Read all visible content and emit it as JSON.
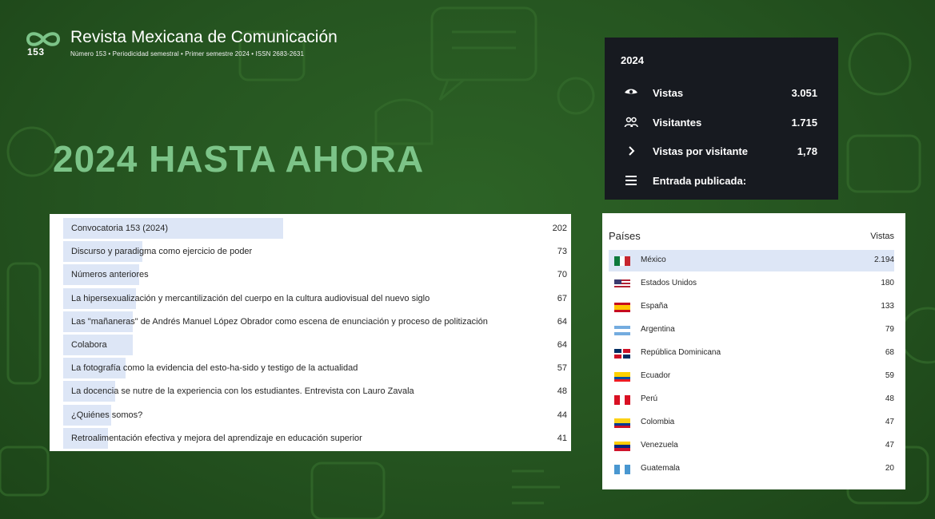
{
  "header": {
    "logo_number": "153",
    "title": "Revista Mexicana de Comunicación",
    "subtitle": "Número 153  •  Periodicidad semestral  •  Primer semestre 2024  •  ISSN 2683-2631"
  },
  "headline": "2024 HASTA AHORA",
  "stats": {
    "year": "2024",
    "rows": [
      {
        "icon": "eye-icon",
        "label": "Vistas",
        "value": "3.051"
      },
      {
        "icon": "people-icon",
        "label": "Visitantes",
        "value": "1.715"
      },
      {
        "icon": "chevron-right-icon",
        "label": "Vistas por visitante",
        "value": "1,78"
      },
      {
        "icon": "list-icon",
        "label": "Entrada publicada:",
        "value": ""
      }
    ]
  },
  "posts": {
    "rows": [
      {
        "label": "Convocatoria 153 (2024)",
        "value": 202
      },
      {
        "label": "Discurso y paradigma como ejercicio de poder",
        "value": 73
      },
      {
        "label": "Números anteriores",
        "value": 70
      },
      {
        "label": "La hipersexualización y mercantilización del cuerpo en la cultura audiovisual del nuevo siglo",
        "value": 67
      },
      {
        "label": "Las \"mañaneras\" de Andrés Manuel López Obrador como escena de enunciación y proceso de politización",
        "value": 64
      },
      {
        "label": "Colabora",
        "value": 64
      },
      {
        "label": "La fotografía como la evidencia del esto-ha-sido y testigo de la actualidad",
        "value": 57
      },
      {
        "label": "La docencia se nutre de la experiencia con los estudiantes. Entrevista con Lauro Zavala",
        "value": 48
      },
      {
        "label": "¿Quiénes somos?",
        "value": 44
      },
      {
        "label": "Retroalimentación efectiva y mejora del aprendizaje en educación superior",
        "value": 41
      }
    ]
  },
  "countries": {
    "title": "Países",
    "column": "Vistas",
    "rows": [
      {
        "name": "México",
        "value": "2.194",
        "flag": "mexico-flag-icon"
      },
      {
        "name": "Estados Unidos",
        "value": "180",
        "flag": "usa-flag-icon"
      },
      {
        "name": "España",
        "value": "133",
        "flag": "spain-flag-icon"
      },
      {
        "name": "Argentina",
        "value": "79",
        "flag": "argentina-flag-icon"
      },
      {
        "name": "República Dominicana",
        "value": "68",
        "flag": "dominican-republic-flag-icon"
      },
      {
        "name": "Ecuador",
        "value": "59",
        "flag": "ecuador-flag-icon"
      },
      {
        "name": "Perú",
        "value": "48",
        "flag": "peru-flag-icon"
      },
      {
        "name": "Colombia",
        "value": "47",
        "flag": "colombia-flag-icon"
      },
      {
        "name": "Venezuela",
        "value": "47",
        "flag": "venezuela-flag-icon"
      },
      {
        "name": "Guatemala",
        "value": "20",
        "flag": "guatemala-flag-icon"
      }
    ]
  },
  "colors": {
    "background": "#2a5a23",
    "headline": "#7cc488",
    "stats_card": "#171a20",
    "bar": "#dde6f6"
  }
}
